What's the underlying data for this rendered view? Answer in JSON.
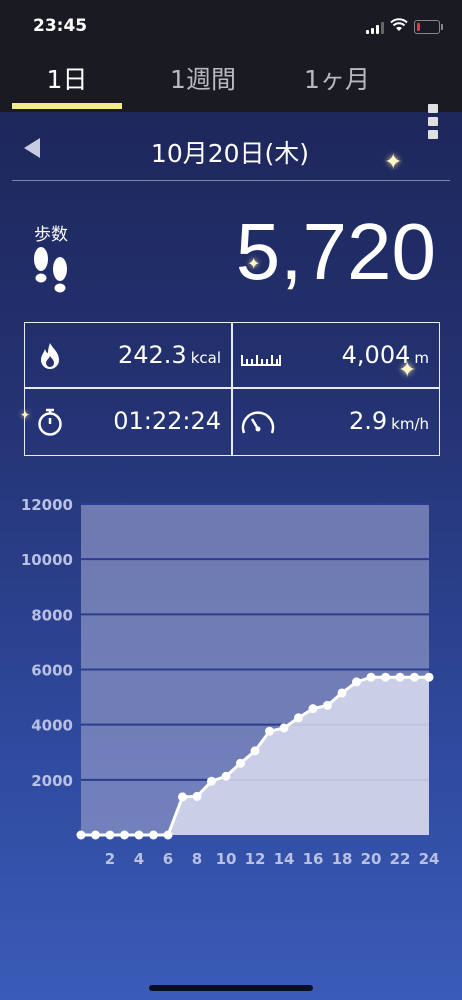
{
  "status_bar": {
    "time": "23:45"
  },
  "tabs": [
    {
      "label": "1日",
      "active": true
    },
    {
      "label": "1週間",
      "active": false
    },
    {
      "label": "1ヶ月",
      "active": false
    }
  ],
  "date": {
    "label": "10月20日(木)"
  },
  "steps": {
    "label": "歩数",
    "value": "5,720"
  },
  "stats": {
    "calories": {
      "value": "242.3",
      "unit": "kcal",
      "icon": "flame-icon"
    },
    "distance": {
      "value": "4,004",
      "unit": "m",
      "icon": "ruler-icon"
    },
    "duration": {
      "value": "01:22:24",
      "unit": "",
      "icon": "stopwatch-icon"
    },
    "speed": {
      "value": "2.9",
      "unit": "km/h",
      "icon": "speedometer-icon"
    }
  },
  "colors": {
    "accent_underline": "#f3ea8a",
    "tab_bar": "#1a1a22"
  },
  "chart_data": {
    "type": "area",
    "x": [
      0,
      1,
      2,
      3,
      4,
      5,
      6,
      7,
      8,
      9,
      10,
      11,
      12,
      13,
      14,
      15,
      16,
      17,
      18,
      19,
      20,
      21,
      22,
      23,
      24
    ],
    "values": [
      0,
      0,
      0,
      0,
      0,
      0,
      0,
      1380,
      1400,
      1950,
      2130,
      2600,
      3050,
      3760,
      3880,
      4250,
      4580,
      4700,
      5150,
      5550,
      5720,
      5720,
      5720,
      5720,
      5720
    ],
    "x_tick_labels": [
      "2",
      "4",
      "6",
      "8",
      "10",
      "12",
      "14",
      "16",
      "18",
      "20",
      "22",
      "24"
    ],
    "y_tick_labels": [
      "2000",
      "4000",
      "6000",
      "8000",
      "10000",
      "12000"
    ],
    "ylim": [
      0,
      12000
    ],
    "xlim": [
      0,
      24
    ],
    "grid": true
  }
}
